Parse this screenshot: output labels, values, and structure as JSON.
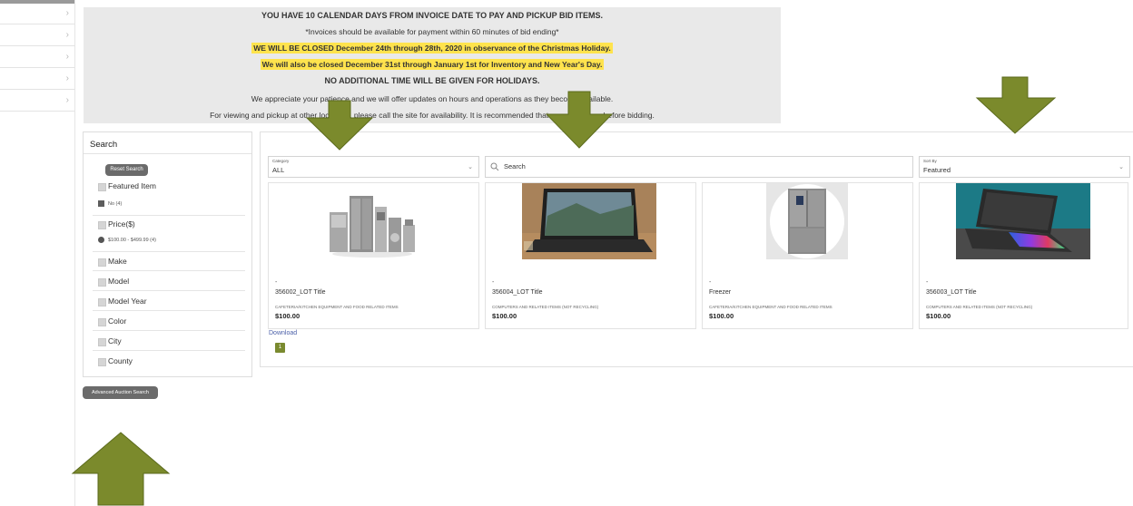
{
  "notice": {
    "line1": "YOU HAVE 10 CALENDAR DAYS FROM INVOICE DATE TO PAY AND PICKUP BID ITEMS.",
    "line2": "*Invoices should be available for payment within 60 minutes of bid ending*",
    "line3": "WE WILL BE CLOSED December 24th through 28th, 2020 in observance of the Christmas Holiday.",
    "line4": "We will also be closed December 31st through January 1st for Inventory and New Year's Day.",
    "line5": "NO ADDITIONAL TIME WILL BE GIVEN FOR HOLIDAYS.",
    "line6": "We appreciate your patience and we will offer updates on hours and operations as they become available.",
    "line7": "For viewing and pickup at other locations, please call the site for availability. It is recommended that you view items before bidding."
  },
  "sidebar": {
    "title": "Search",
    "reset_label": "Reset Search",
    "filters": {
      "featured": {
        "label": "Featured Item",
        "option": "No (4)"
      },
      "price": {
        "label": "Price($)",
        "option": "$100.00 - $499.99 (4)"
      },
      "make": "Make",
      "model": "Model",
      "model_year": "Model Year",
      "color": "Color",
      "city": "City",
      "county": "County"
    },
    "advanced_label": "Advanced Auction Search"
  },
  "toolbar": {
    "category_label": "Category",
    "category_value": "ALL",
    "search_placeholder": "Search",
    "sort_label": "Sort By",
    "sort_value": "Featured"
  },
  "cards": [
    {
      "dash": "-",
      "title": "356002_LOT Title",
      "category": "CAFETERIA/KITCHEN EQUIPMENT AND FOOD RELATED ITEMS",
      "price": "$100.00"
    },
    {
      "dash": "-",
      "title": "356004_LOT Title",
      "category": "COMPUTERS AND RELATED ITEMS (NOT RECYCLING)",
      "price": "$100.00"
    },
    {
      "dash": "-",
      "title": "Freezer",
      "category": "CAFETERIA/KITCHEN EQUIPMENT AND FOOD RELATED ITEMS",
      "price": "$100.00"
    },
    {
      "dash": "-",
      "title": "356003_LOT Title",
      "category": "COMPUTERS AND RELATED ITEMS (NOT RECYCLING)",
      "price": "$100.00"
    }
  ],
  "download_label": "Download",
  "page_number": "1",
  "colors": {
    "arrow": "#7b8a2c",
    "arrow_border": "#5b6a1c",
    "highlight": "#ffe34d",
    "page_button": "#7a8a2f"
  },
  "icons": [
    "chevron-right-icon",
    "search-icon",
    "chevron-down-icon",
    "down-arrow-icon",
    "up-arrow-icon"
  ]
}
